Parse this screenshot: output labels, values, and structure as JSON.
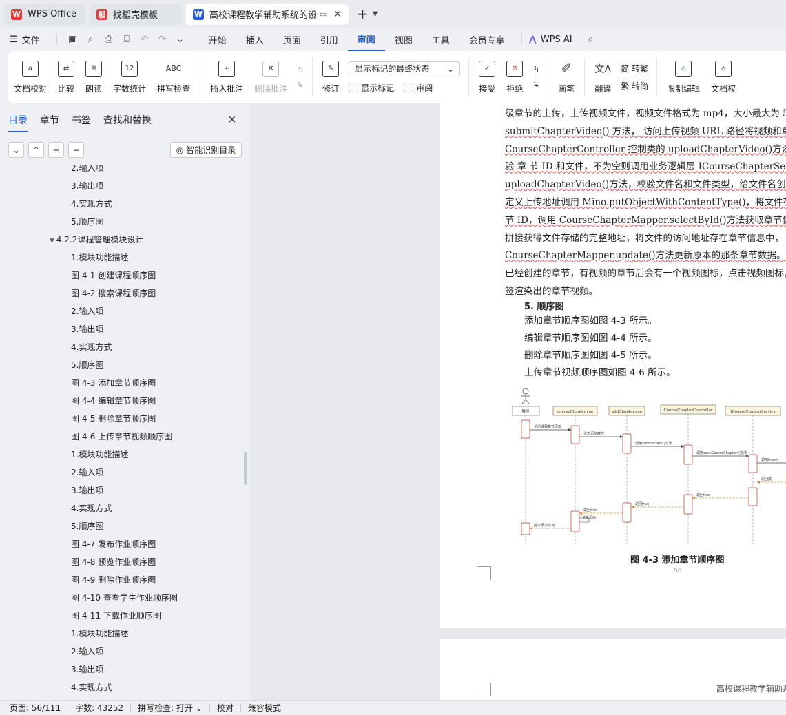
{
  "tabs": [
    {
      "label": "WPS Office",
      "icon": "wps-logo-icon",
      "color": "#e53935"
    },
    {
      "label": "找稻壳模板",
      "icon": "docer-logo-icon",
      "color": "#e53935"
    },
    {
      "label": "高校课程教学辅助系统的设计与",
      "icon": "word-doc-icon",
      "color": "#2b5fd9"
    }
  ],
  "menu": {
    "file": "文件",
    "items": [
      "开始",
      "插入",
      "页面",
      "引用",
      "审阅",
      "视图",
      "工具",
      "会员专享"
    ],
    "active": "审阅",
    "wps_ai": "WPS AI"
  },
  "ribbon": {
    "doc_check": "文档校对",
    "compare": "比较",
    "read_aloud": "朗读",
    "word_count": "字数统计",
    "spell_check": "拼写检查",
    "insert_comment": "插入批注",
    "delete_comment": "删除批注",
    "track_changes": "修订",
    "markup_mode": "显示标记的最终状态",
    "show_markup": "显示标记",
    "review_pane": "审阅",
    "accept": "接受",
    "reject": "拒绝",
    "pen": "画笔",
    "translate": "翻译",
    "to_traditional": "简 转繁",
    "to_simplified": "繁 转简",
    "restrict_edit": "限制编辑",
    "doc_permission": "文档权"
  },
  "panel": {
    "tabs": [
      "目录",
      "章节",
      "书签",
      "查找和替换"
    ],
    "active_tab": "目录",
    "ai_button": "智能识别目录",
    "toc": [
      {
        "text": "2.输入项",
        "level": 3
      },
      {
        "text": "3.输出项",
        "level": 3
      },
      {
        "text": "4.实现方式",
        "level": 3
      },
      {
        "text": "5.顺序图",
        "level": 3
      },
      {
        "text": "4.2.2课程管理模块设计",
        "level": 2
      },
      {
        "text": "1.模块功能描述",
        "level": 3
      },
      {
        "text": "图 4-1  创建课程顺序图",
        "level": 3
      },
      {
        "text": "图 4-2  搜索课程顺序图",
        "level": 3
      },
      {
        "text": "2.输入项",
        "level": 3
      },
      {
        "text": "3.输出项",
        "level": 3
      },
      {
        "text": "4.实现方式",
        "level": 3
      },
      {
        "text": "5.顺序图",
        "level": 3
      },
      {
        "text": "图 4-3  添加章节顺序图",
        "level": 3
      },
      {
        "text": "图 4-4  编辑章节顺序图",
        "level": 3
      },
      {
        "text": "图 4-5  删除章节顺序图",
        "level": 3
      },
      {
        "text": "图 4-6  上传章节视频顺序图",
        "level": 3
      },
      {
        "text": "1.模块功能描述",
        "level": 3
      },
      {
        "text": "2.输入项",
        "level": 3
      },
      {
        "text": "3.输出项",
        "level": 3
      },
      {
        "text": "4.实现方式",
        "level": 3
      },
      {
        "text": "5.顺序图",
        "level": 3
      },
      {
        "text": "图 4-7  发布作业顺序图",
        "level": 3
      },
      {
        "text": "图 4-8  预览作业顺序图",
        "level": 3
      },
      {
        "text": "图 4-9  删除作业顺序图",
        "level": 3
      },
      {
        "text": "图 4-10  查看学生作业顺序图",
        "level": 3
      },
      {
        "text": "图 4-11  下载作业顺序图",
        "level": 3
      },
      {
        "text": "1.模块功能描述",
        "level": 3
      },
      {
        "text": "2.输入项",
        "level": 3
      },
      {
        "text": "3.输出项",
        "level": 3
      },
      {
        "text": "4.实现方式",
        "level": 3
      }
    ]
  },
  "document": {
    "lines": [
      {
        "text": "级章节的上传，上传视频文件，视频文件格式为  mp4，大小最大为  5",
        "underline": false
      },
      {
        "text": "submitChapterVideo() 方法，  访问上传视频  URL 路径将视频和章节  I",
        "underline": true
      },
      {
        "text": "CourseChapterController 控制类的  uploadChapterVideo()方法中，用  Ot",
        "underline": true
      },
      {
        "text": "验 章 节 ID 和文件，不为空则调用业务逻辑层 ICourseChapterServ",
        "underline": true
      },
      {
        "text": "uploadChapterVideo()方法，校验文件名和文件类型，给文件名创建一个新",
        "underline": true
      },
      {
        "text": "定义上传地址调用  Mino.putObjectWithContentType()，将文件存储在  M",
        "underline": true
      },
      {
        "text": "节 ID，调用  CourseChapterMapper.selectById()方法获取章节信息，将地",
        "underline": true
      },
      {
        "text": "拼接获得文件存储的完整地址，将文件的访问地址存在章节信息中，",
        "underline": false
      },
      {
        "text": "CourseChapterMapper.update()方法更新原本的那条章节数据。学生在章",
        "underline": true
      },
      {
        "text": "已经创建的章节，有视频的章节后会有一个视频图标，点击视频图标，会",
        "underline": false
      },
      {
        "text": "签渲染出的章节视频。",
        "underline": false
      }
    ],
    "section5_title": "5. 顺序图",
    "section5_items": [
      "添加章节顺序图如图  4-3 所示。",
      "编辑章节顺序图如图  4-4 所示。",
      "删除章节顺序图如图  4-5 所示。",
      "上传章节视频顺序图如图  4-6 所示。"
    ],
    "diagram": {
      "actors": [
        "教师",
        "courseChapter.vue",
        "addChapter.vue",
        "CourseChapterController",
        "ICourseChapterService"
      ],
      "messages": [
        "访问课程章节页面",
        "点击添加章节",
        "调用submitForm()方法",
        "调用saveCourseChapter()方法",
        "调用insert",
        "返回成",
        "返回true",
        "返回true",
        "返回true",
        "渲染页面",
        "提示添加成功"
      ]
    },
    "caption": "图 4-3  添加章节顺序图",
    "page_number": "50",
    "next_page_header": "高校课程教学辅助系"
  },
  "status": {
    "page": "页面: 56/111",
    "words": "字数: 43252",
    "spell": "拼写检查: 打开",
    "proof": "校对",
    "compat": "兼容模式"
  }
}
